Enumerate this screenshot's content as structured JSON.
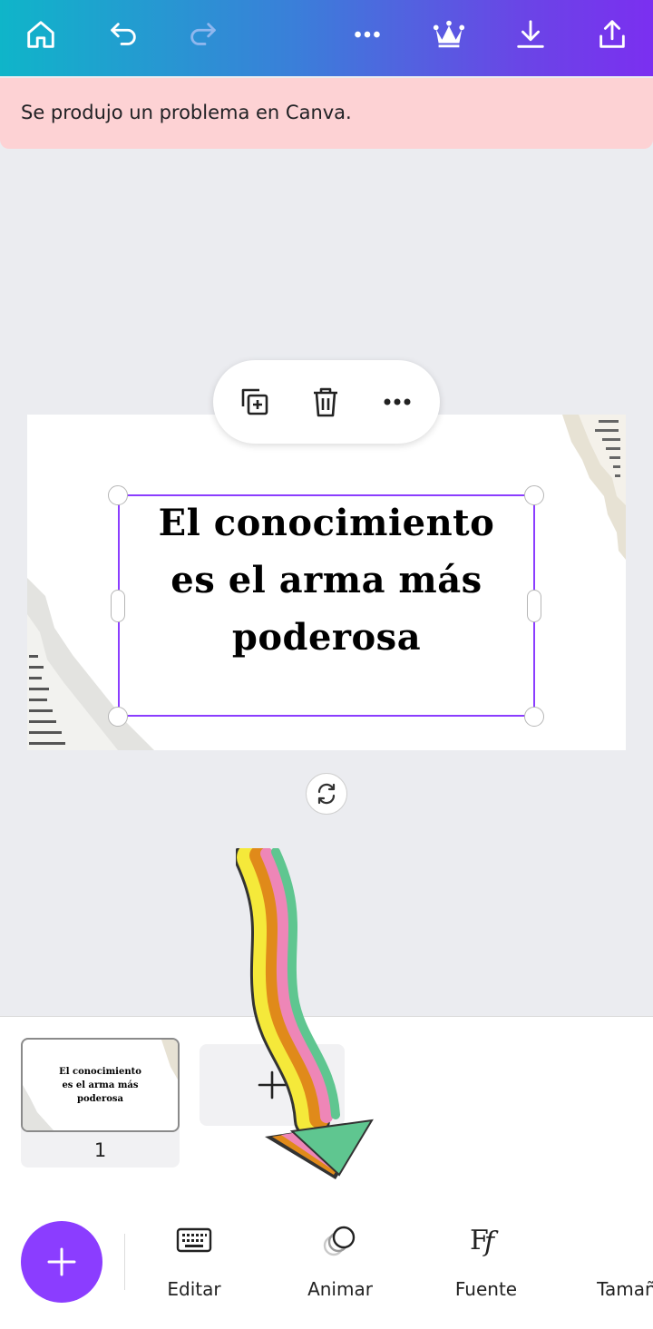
{
  "alert": {
    "message": "Se produjo un problema en Canva."
  },
  "design": {
    "quote_lines": [
      "El conocimiento",
      "es el arma más",
      "poderosa"
    ]
  },
  "pages": {
    "thumbnail_number": "1"
  },
  "toolbar": {
    "items": [
      {
        "label": "Editar",
        "icon": "keyboard-icon"
      },
      {
        "label": "Animar",
        "icon": "animate-icon"
      },
      {
        "label": "Fuente",
        "icon": "font-icon"
      },
      {
        "label": "Tamaño",
        "icon": "text-size-icon"
      }
    ]
  },
  "colors": {
    "accent": "#8b3dff",
    "alert_bg": "#fdd2d4",
    "topbar_gradient_start": "#0fb5c9",
    "topbar_gradient_end": "#7b2ff0"
  }
}
